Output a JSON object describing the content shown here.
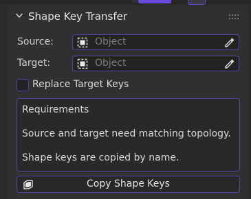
{
  "panel": {
    "title": "Shape Key Transfer",
    "expanded": true
  },
  "fields": {
    "source": {
      "label": "Source:",
      "placeholder": "Object"
    },
    "target": {
      "label": "Target:",
      "placeholder": "Object"
    }
  },
  "options": {
    "replace_target_keys": {
      "label": "Replace Target Keys",
      "checked": false
    }
  },
  "requirements": {
    "heading": "Requirements",
    "lines": [
      "Source and target need matching topology.",
      "Shape keys are copied by name."
    ]
  },
  "actions": {
    "copy_label": "Copy Shape Keys"
  },
  "colors": {
    "accent": "#5a3fa8",
    "accent_bright": "#6a4ad8",
    "panel_bg": "#303030",
    "window_bg": "#2b2b2b"
  },
  "icons": {
    "collapse": "chevron-down-icon",
    "grip": "drag-grip-icon",
    "object": "object-icon",
    "eyedropper": "eyedropper-icon",
    "copy": "shape-keys-icon"
  }
}
